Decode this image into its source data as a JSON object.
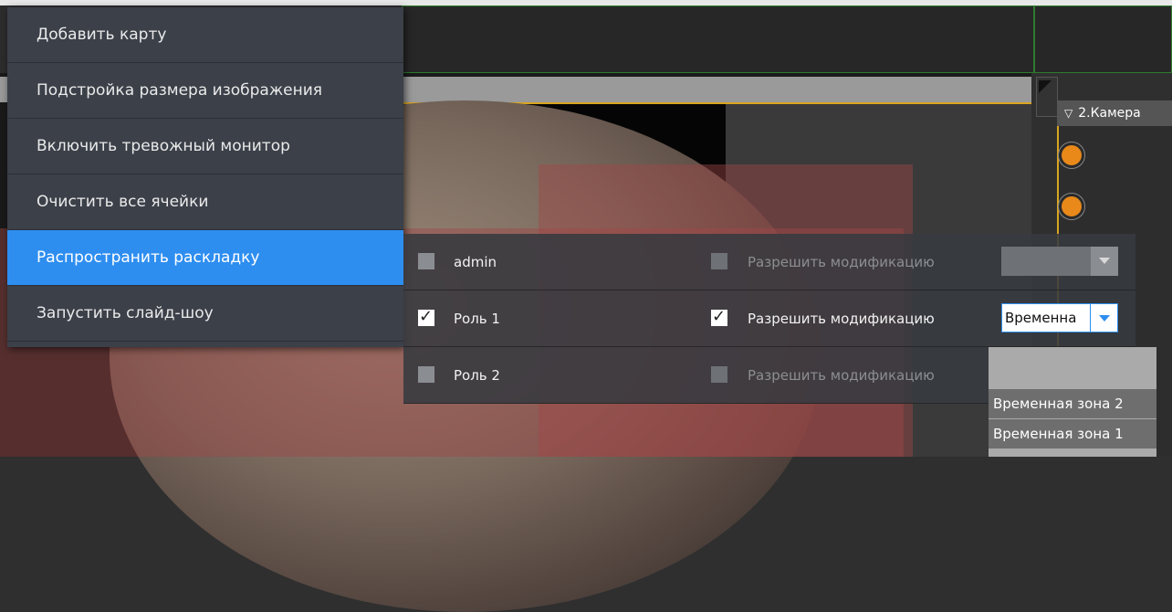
{
  "context_menu": {
    "items": [
      {
        "label": "Добавить карту"
      },
      {
        "label": "Подстройка размера изображения"
      },
      {
        "label": "Включить тревожный монитор"
      },
      {
        "label": "Очистить все ячейки"
      },
      {
        "label": "Распространить раскладку",
        "active": true
      },
      {
        "label": "Запустить слайд-шоу"
      }
    ]
  },
  "roles_submenu": {
    "rows": [
      {
        "role": "admin",
        "role_checked": false,
        "permission_label": "Разрешить модификацию",
        "permission_checked": false,
        "permission_enabled": false,
        "time_zone": "",
        "time_zone_enabled": false
      },
      {
        "role": "Роль 1",
        "role_checked": true,
        "permission_label": "Разрешить модификацию",
        "permission_checked": true,
        "permission_enabled": true,
        "time_zone": "Временна",
        "time_zone_enabled": true
      },
      {
        "role": "Роль 2",
        "role_checked": false,
        "permission_label": "Разрешить модификацию",
        "permission_checked": false,
        "permission_enabled": false
      }
    ]
  },
  "time_zone_dropdown": {
    "options": [
      "Временная зона 2",
      "Временная зона 1"
    ]
  },
  "camera_panel": {
    "title": "2.Камера"
  },
  "colors": {
    "menu_bg": "#3b4049",
    "menu_active": "#2e8ef0",
    "grid_border": "#2f7a2f",
    "selection_border": "#d9a520",
    "status_dot": "#e8891a"
  }
}
